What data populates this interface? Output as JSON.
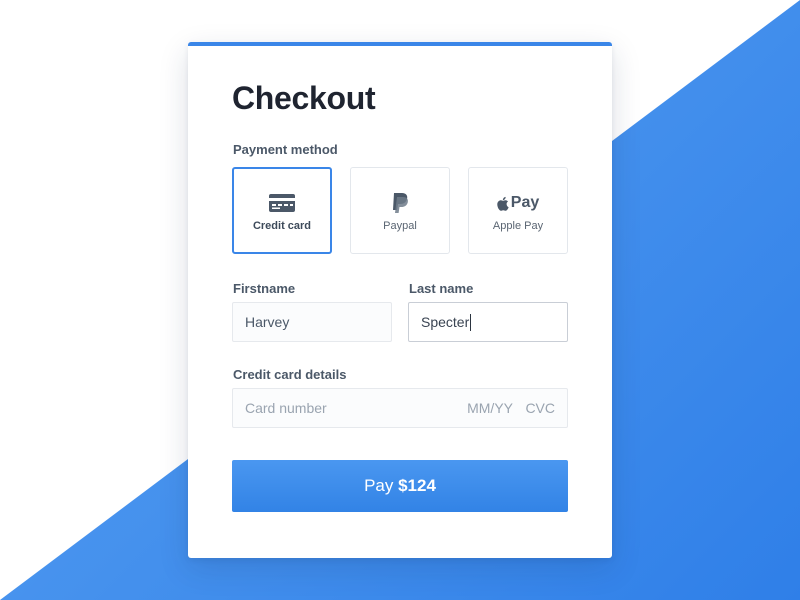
{
  "checkout": {
    "title": "Checkout",
    "payment_method_label": "Payment method",
    "payment_methods": [
      {
        "label": "Credit card",
        "icon": "credit-card-icon",
        "selected": true
      },
      {
        "label": "Paypal",
        "icon": "paypal-icon",
        "selected": false
      },
      {
        "label": "Apple Pay",
        "icon": "apple-pay-icon",
        "selected": false
      }
    ],
    "apple_pay_mark": "Pay",
    "firstname_label": "Firstname",
    "firstname_value": "Harvey",
    "lastname_label": "Last name",
    "lastname_value": "Specter",
    "card_details_label": "Credit card details",
    "card_number_placeholder": "Card number",
    "expiry_placeholder": "MM/YY",
    "cvc_placeholder": "CVC",
    "pay_button": {
      "prefix": "Pay",
      "amount": "$124"
    }
  },
  "colors": {
    "accent": "#3a86e8",
    "background_gradient_start": "#5aa2f2",
    "background_gradient_end": "#2f7fe8",
    "title_text": "#1f2430",
    "label_text": "#4b5868"
  }
}
